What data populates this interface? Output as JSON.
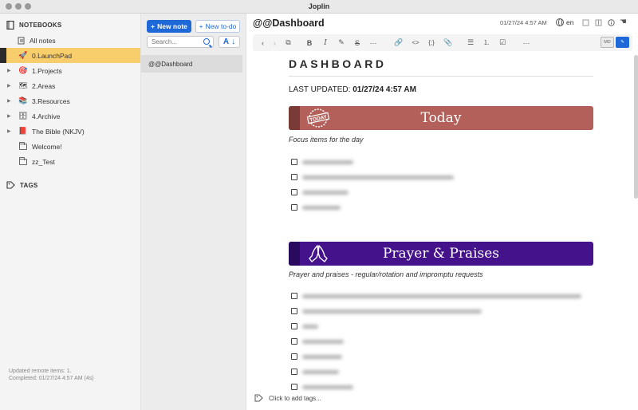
{
  "window": {
    "title": "Joplin"
  },
  "sidebar": {
    "notebooks_heading": "NOTEBOOKS",
    "items": [
      {
        "label": "All notes",
        "icon": "all-notes-icon",
        "active": false,
        "expandable": false
      },
      {
        "label": "0.LaunchPad",
        "icon": "rocket-icon",
        "active": true,
        "expandable": false
      },
      {
        "label": "1.Projects",
        "icon": "target-icon",
        "active": false,
        "expandable": true
      },
      {
        "label": "2.Areas",
        "icon": "map-icon",
        "active": false,
        "expandable": true
      },
      {
        "label": "3.Resources",
        "icon": "books-icon",
        "active": false,
        "expandable": true
      },
      {
        "label": "4.Archive",
        "icon": "archive-box-icon",
        "active": false,
        "expandable": true
      },
      {
        "label": "The Bible (NKJV)",
        "icon": "bible-icon",
        "active": false,
        "expandable": true
      },
      {
        "label": "Welcome!",
        "icon": "folder-icon",
        "active": false,
        "expandable": false
      },
      {
        "label": "zz_Test",
        "icon": "folder-icon",
        "active": false,
        "expandable": false
      }
    ],
    "tags_heading": "TAGS",
    "sync_status": [
      "Updated remote items: 1.",
      "Completed: 01/27/24 4:57 AM (4s)"
    ]
  },
  "notelist": {
    "new_note_label": "New note",
    "new_todo_label": "New to-do",
    "search_placeholder": "Search...",
    "sort_label": "A",
    "notes": [
      {
        "title": "@@Dashboard",
        "selected": true
      }
    ]
  },
  "editor": {
    "title": "@@Dashboard",
    "date": "01/27/24 4:57 AM",
    "language": "en",
    "tags_prompt": "Click to add tags..."
  },
  "note_content": {
    "heading": "DASHBOARD",
    "updated_prefix": "LAST UPDATED:",
    "updated_value": "01/27/24 4:57 AM",
    "sections": [
      {
        "title": "Today",
        "badge": "TODAY",
        "color": "#b4605a",
        "stripe_color": "#7a3a36",
        "subtitle": "Focus items for the day",
        "task_count": 4
      },
      {
        "title": "Prayer & Praises",
        "badge": "praying-hands",
        "color": "#44138b",
        "stripe_color": "#2a0a5e",
        "subtitle": "Prayer and praises - regular/rotation and impromptu requests",
        "task_count": 7
      }
    ]
  },
  "colors": {
    "accent": "#1f68d8",
    "active_notebook": "#f8cd6c"
  }
}
